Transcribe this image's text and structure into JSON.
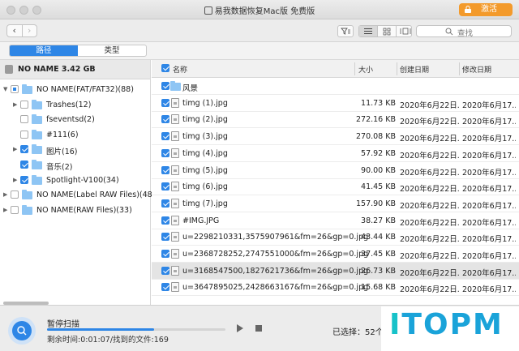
{
  "window": {
    "title": "易我数据恢复Mac版 免费版",
    "activate_label": "激活"
  },
  "toolbar": {
    "back": "‹",
    "forward": "›",
    "search_placeholder": "查找"
  },
  "tabs": [
    {
      "label": "路径",
      "active": true
    },
    {
      "label": "类型",
      "active": false
    }
  ],
  "drive": {
    "label": "NO NAME 3.42 GB"
  },
  "tree": [
    {
      "label": "NO NAME(FAT/FAT32)(88)",
      "expanded": true,
      "check": "partial",
      "level": 0
    },
    {
      "label": "Trashes(12)",
      "expanded": false,
      "check": "none",
      "level": 1,
      "hasToggle": true
    },
    {
      "label": "fseventsd(2)",
      "check": "none",
      "level": 1,
      "hasToggle": false
    },
    {
      "label": "#111(6)",
      "check": "none",
      "level": 1,
      "hasToggle": false
    },
    {
      "label": "图片(16)",
      "expanded": false,
      "check": "checked",
      "level": 1,
      "hasToggle": true
    },
    {
      "label": "音乐(2)",
      "check": "checked",
      "level": 1,
      "hasToggle": false
    },
    {
      "label": "Spotlight-V100(34)",
      "expanded": false,
      "check": "checked",
      "level": 1,
      "hasToggle": true
    },
    {
      "label": "NO NAME(Label RAW Files)(48)",
      "expanded": false,
      "check": "none",
      "level": 0,
      "hasToggle": true
    },
    {
      "label": "NO NAME(RAW Files)(33)",
      "expanded": false,
      "check": "none",
      "level": 0,
      "hasToggle": true
    }
  ],
  "table": {
    "headers": {
      "name": "名称",
      "size": "大小",
      "created": "创建日期",
      "modified": "修改日期"
    },
    "rows": [
      {
        "name": "风景",
        "type": "folder",
        "size": "",
        "created": "",
        "modified": ""
      },
      {
        "name": "timg (1).jpg",
        "type": "file",
        "size": "11.73 KB",
        "created": "2020年6月22日...",
        "modified": "2020年6月17..."
      },
      {
        "name": "timg (2).jpg",
        "type": "file",
        "size": "272.16 KB",
        "created": "2020年6月22日...",
        "modified": "2020年6月17..."
      },
      {
        "name": "timg (3).jpg",
        "type": "file",
        "size": "270.08 KB",
        "created": "2020年6月22日...",
        "modified": "2020年6月17..."
      },
      {
        "name": "timg (4).jpg",
        "type": "file",
        "size": "57.92 KB",
        "created": "2020年6月22日...",
        "modified": "2020年6月17..."
      },
      {
        "name": "timg (5).jpg",
        "type": "file",
        "size": "90.00 KB",
        "created": "2020年6月22日...",
        "modified": "2020年6月17..."
      },
      {
        "name": "timg (6).jpg",
        "type": "file",
        "size": "41.45 KB",
        "created": "2020年6月22日...",
        "modified": "2020年6月17..."
      },
      {
        "name": "timg (7).jpg",
        "type": "file",
        "size": "157.90 KB",
        "created": "2020年6月22日...",
        "modified": "2020年6月17..."
      },
      {
        "name": "#IMG.JPG",
        "type": "file",
        "size": "38.27 KB",
        "created": "2020年6月22日...",
        "modified": "2020年6月17..."
      },
      {
        "name": "u=2298210331,3575907961&fm=26&gp=0.jpg",
        "type": "file",
        "size": "43.44 KB",
        "created": "2020年6月22日...",
        "modified": "2020年6月17..."
      },
      {
        "name": "u=2368728252,2747551000&fm=26&gp=0.jpg",
        "type": "file",
        "size": "37.45 KB",
        "created": "2020年6月22日...",
        "modified": "2020年6月17..."
      },
      {
        "name": "u=3168547500,1827621736&fm=26&gp=0.jpg",
        "type": "file",
        "size": "26.73 KB",
        "created": "2020年6月22日...",
        "modified": "2020年6月17...",
        "selected": true
      },
      {
        "name": "u=3647895025,2428663167&fm=26&gp=0.jpg",
        "type": "file",
        "size": "15.68 KB",
        "created": "2020年6月22日...",
        "modified": "2020年6月17..."
      }
    ]
  },
  "status": {
    "title": "暂停扫描",
    "progress": 0.6,
    "remaining": "剩余时间:0:01:07/找到的文件:169",
    "selected": "已选择：52个文"
  },
  "watermark": {
    "text_i": "I",
    "text_rest": "TOPM"
  },
  "colors": {
    "accent": "#2e86e6",
    "activate": "#f39a2b",
    "folder": "#8ec5f4"
  }
}
